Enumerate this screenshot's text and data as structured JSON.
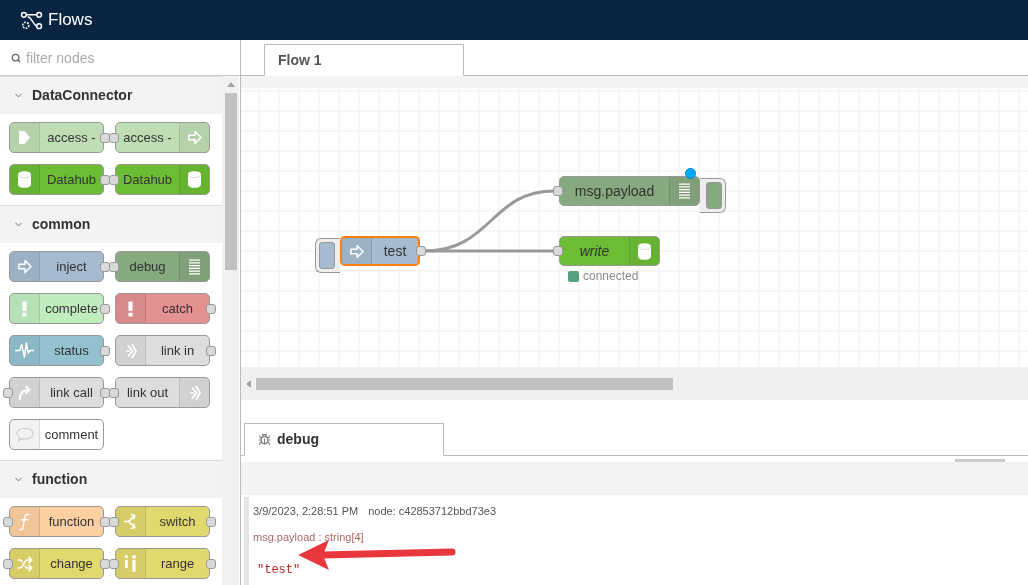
{
  "header": {
    "title": "Flows"
  },
  "palette": {
    "filter": {
      "placeholder": "filter nodes"
    },
    "categories": [
      {
        "name": "DataConnector",
        "expanded": true,
        "nodes": [
          {
            "label": "access -",
            "kind": "input",
            "color": "#c0deb5",
            "icon_right": false,
            "input": false,
            "output": true
          },
          {
            "label": "access -",
            "kind": "output",
            "color": "#c0deb5",
            "icon_right": true,
            "input": true,
            "output": false
          },
          {
            "label": "Datahub",
            "kind": "database",
            "color": "#6cbd34",
            "icon_right": false,
            "input": false,
            "output": true
          },
          {
            "label": "Datahub",
            "kind": "database",
            "color": "#6cbd34",
            "icon_right": true,
            "input": true,
            "output": false
          }
        ]
      },
      {
        "name": "common",
        "expanded": true,
        "nodes": [
          {
            "label": "inject",
            "kind": "inject",
            "color": "#a6bbcf",
            "icon_right": false,
            "input": false,
            "output": true
          },
          {
            "label": "debug",
            "kind": "debug",
            "color": "#87a980",
            "icon_right": true,
            "input": true,
            "output": false
          },
          {
            "label": "complete",
            "kind": "alert",
            "color": "#c0edc0",
            "icon_right": false,
            "input": false,
            "output": true
          },
          {
            "label": "catch",
            "kind": "alert",
            "color": "#e49191",
            "icon_right": false,
            "input": false,
            "output": true
          },
          {
            "label": "status",
            "kind": "status",
            "color": "#94c1d0",
            "icon_right": false,
            "input": false,
            "output": true
          },
          {
            "label": "link in",
            "kind": "linkin",
            "color": "#dddddd",
            "icon_right": false,
            "input": false,
            "output": true
          },
          {
            "label": "link call",
            "kind": "linkcall",
            "color": "#dddddd",
            "icon_right": false,
            "input": true,
            "output": true
          },
          {
            "label": "link out",
            "kind": "linkout",
            "color": "#dddddd",
            "icon_right": true,
            "input": true,
            "output": false
          },
          {
            "label": "comment",
            "kind": "comment",
            "color": "#ffffff",
            "icon_right": false,
            "input": false,
            "output": false
          }
        ]
      },
      {
        "name": "function",
        "expanded": true,
        "nodes": [
          {
            "label": "function",
            "kind": "function",
            "color": "#fdd0a2",
            "icon_right": false,
            "input": true,
            "output": true
          },
          {
            "label": "switch",
            "kind": "switch",
            "color": "#e2d96e",
            "icon_right": false,
            "input": true,
            "output": true
          },
          {
            "label": "change",
            "kind": "change",
            "color": "#e2d96e",
            "icon_right": false,
            "input": true,
            "output": true
          },
          {
            "label": "range",
            "kind": "range",
            "color": "#e2d96e",
            "icon_right": false,
            "input": true,
            "output": true
          }
        ]
      }
    ]
  },
  "flow": {
    "tabs": [
      {
        "label": "Flow 1",
        "selected": true
      }
    ],
    "nodes": [
      {
        "label": "test",
        "kind": "inject",
        "color": "#a6bbcf",
        "selected": true,
        "changed": false,
        "italic": false
      },
      {
        "label": "msg.payload",
        "kind": "debug",
        "color": "#87a980",
        "selected": false,
        "changed": true,
        "italic": false
      },
      {
        "label": "write",
        "kind": "database",
        "color": "#6cbd34",
        "selected": false,
        "changed": false,
        "italic": true,
        "status": {
          "text": "connected",
          "color": "#55a07e"
        }
      }
    ]
  },
  "debug": {
    "tabs": [
      {
        "label": "debug",
        "selected": true
      }
    ],
    "messages": [
      {
        "time": "3/9/2023, 2:28:51 PM",
        "node": "node: c42853712bbd73e3",
        "meta": "msg.payload : string[4]",
        "value": "\"test\""
      }
    ],
    "annotation_arrow": true
  }
}
